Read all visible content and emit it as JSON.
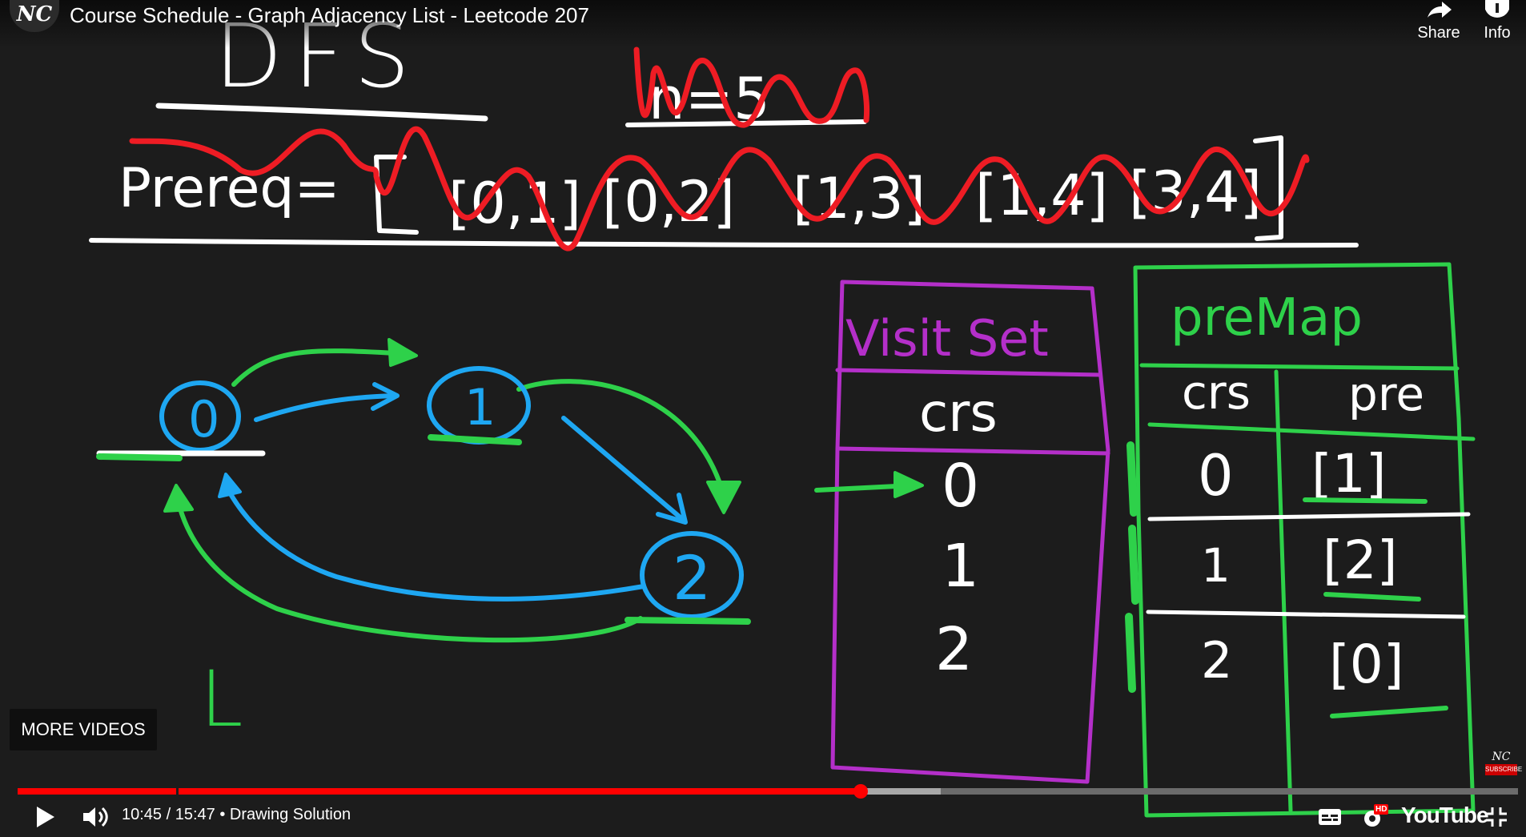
{
  "player": {
    "channel_logo": "NC",
    "video_title": "Course Schedule - Graph Adjacency List - Leetcode 207",
    "share_label": "Share",
    "info_label": "Info",
    "more_videos_label": "MORE VIDEOS",
    "current_time": "10:45",
    "duration": "15:47",
    "time_display": "10:45 / 15:47 • Drawing Solution",
    "chapter": "Drawing Solution",
    "progress_played": 0.562,
    "progress_buffered": 0.615,
    "subscribe_badge": "SUBSCRIBE",
    "subscribe_mini_logo": "NC",
    "hd_badge": "HD",
    "brand_logo": "YouTube",
    "icons": [
      "play-icon",
      "volume-icon",
      "captions-icon",
      "settings-icon",
      "fullscreen-exit-icon",
      "share-icon",
      "info-icon"
    ]
  },
  "board": {
    "heading": "DFS",
    "crossed_text": "n=5",
    "prereq_label": "Prereq=",
    "prereq_pairs": [
      "[0,1]",
      "[0,2]",
      "[1,3]",
      "[1,4]",
      "[3,4]"
    ],
    "graph_nodes": [
      "0",
      "1",
      "2"
    ],
    "cursor_mark": "L",
    "visit_set": {
      "title": "Visit Set",
      "header": "crs",
      "rows": [
        "0",
        "1",
        "2"
      ]
    },
    "pre_map": {
      "title": "preMap",
      "headers": [
        "crs",
        "pre"
      ],
      "rows": [
        {
          "crs": "0",
          "pre": "[1]"
        },
        {
          "crs": "1",
          "pre": "[2]"
        },
        {
          "crs": "2",
          "pre": "[0]"
        }
      ]
    }
  },
  "colors": {
    "background": "#1c1c1c",
    "chalk_white": "#ffffff",
    "green": "#2ed14a",
    "blue": "#1ea7f2",
    "red": "#ee1c24",
    "purple": "#b42fc9",
    "progress_red": "#ff0000"
  }
}
